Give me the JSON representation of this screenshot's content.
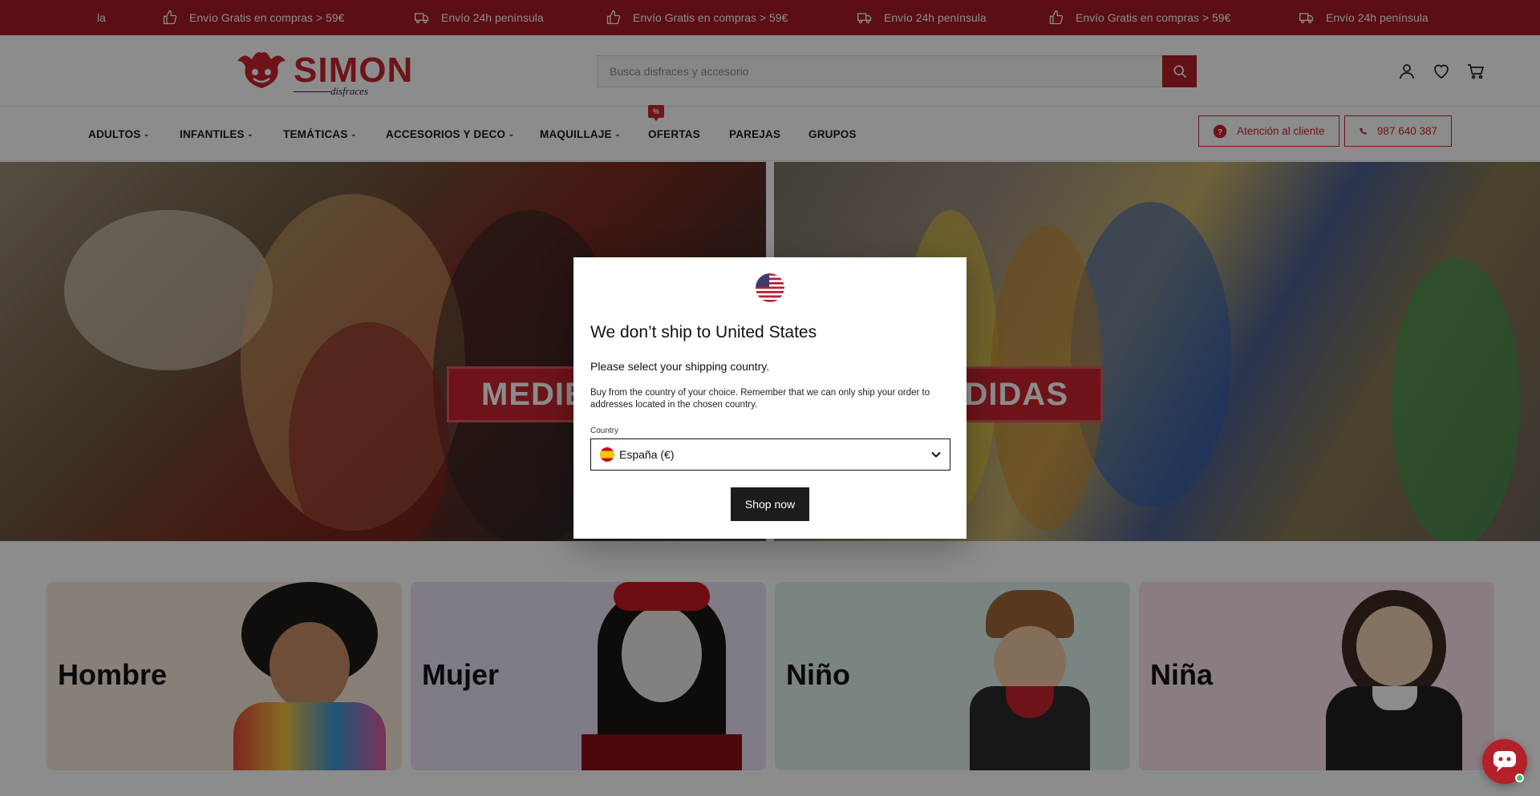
{
  "announcement": {
    "items": [
      {
        "text": "la",
        "icon": "none"
      },
      {
        "text": "Envío Gratis en compras > 59€",
        "icon": "thumbs-up-icon"
      },
      {
        "text": "Envío 24h península",
        "icon": "truck-icon"
      },
      {
        "text": "Envío Gratis en compras > 59€",
        "icon": "thumbs-up-icon"
      },
      {
        "text": "Envío 24h península",
        "icon": "truck-icon"
      },
      {
        "text": "Envío Gratis en compras > 59€",
        "icon": "thumbs-up-icon"
      },
      {
        "text": "Envío 24h península",
        "icon": "truck-icon"
      }
    ]
  },
  "header": {
    "logo_text": "SIMON",
    "logo_sub": "disfraces",
    "search_placeholder": "Busca disfraces y accesorio"
  },
  "nav": {
    "items": [
      {
        "label": "ADULTOS",
        "has_dropdown": true
      },
      {
        "label": "INFANTILES",
        "has_dropdown": true
      },
      {
        "label": "TEMÁTICAS",
        "has_dropdown": true
      },
      {
        "label": "ACCESORIOS Y DECO",
        "has_dropdown": true
      },
      {
        "label": "MAQUILLAJE",
        "has_dropdown": true
      },
      {
        "label": "OFERTAS",
        "has_dropdown": false
      },
      {
        "label": "PAREJAS",
        "has_dropdown": false
      },
      {
        "label": "GRUPOS",
        "has_dropdown": false
      }
    ],
    "offer_badge": "%",
    "customer_service": "Atención al cliente",
    "phone": "987 640 387"
  },
  "hero": {
    "left_label": "MEDIE",
    "right_label": "PEDIDAS"
  },
  "categories": [
    {
      "label": "Hombre",
      "bg": "#f5ead8"
    },
    {
      "label": "Mujer",
      "bg": "#ece0f2"
    },
    {
      "label": "Niño",
      "bg": "#dff2ee"
    },
    {
      "label": "Niña",
      "bg": "#fbe2ef"
    }
  ],
  "modal": {
    "title": "We don’t ship to United States",
    "subtitle": "Please select your shipping country.",
    "note": "Buy from the country of your choice. Remember that we can only ship your order to addresses located in the chosen country.",
    "country_label": "Country",
    "country_value": "España (€)",
    "button": "Shop now"
  },
  "colors": {
    "brand": "#a61a23",
    "accent": "#c9252f"
  }
}
